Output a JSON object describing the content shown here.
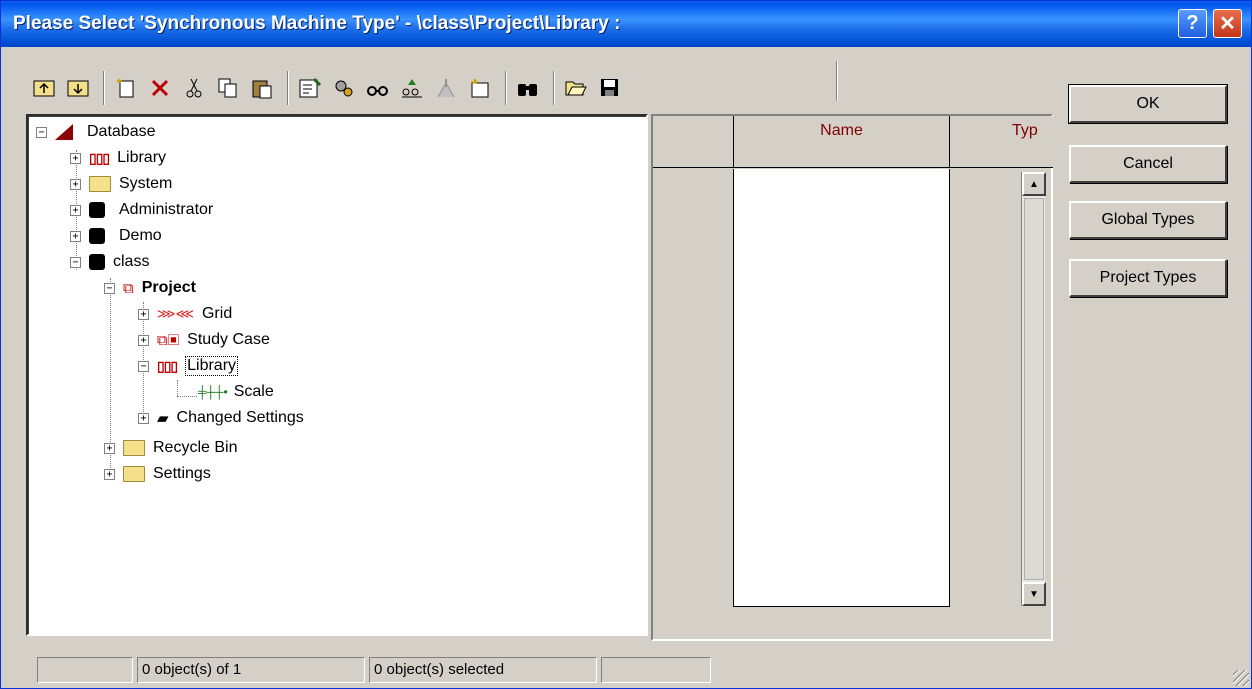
{
  "window": {
    "title": "Please Select 'Synchronous Machine Type' - \\class\\Project\\Library :",
    "help_label": "?",
    "close_label": "✕"
  },
  "toolbar": {
    "icons": [
      "folder-up-icon",
      "folder-down-icon",
      "new-object-icon",
      "delete-icon",
      "cut-icon",
      "copy-icon",
      "paste-icon",
      "edit-icon",
      "settings-icon",
      "view-icon",
      "filter-icon",
      "calculate-icon",
      "new-folder-icon",
      "find-icon",
      "open-icon",
      "save-icon"
    ]
  },
  "tree": {
    "items": [
      {
        "label": "Database",
        "expander": "−",
        "icon": "database-icon"
      },
      {
        "label": "Library",
        "expander": "+",
        "icon": "library-icon"
      },
      {
        "label": "System",
        "expander": "+",
        "icon": "folder-icon"
      },
      {
        "label": "Administrator",
        "expander": "+",
        "icon": "user-icon"
      },
      {
        "label": "Demo",
        "expander": "+",
        "icon": "user-icon"
      },
      {
        "label": "class",
        "expander": "−",
        "icon": "user-icon"
      },
      {
        "label": "Project",
        "expander": "−",
        "icon": "project-icon"
      },
      {
        "label": "Grid",
        "expander": "+",
        "icon": "grid-icon"
      },
      {
        "label": "Study Case",
        "expander": "+",
        "icon": "study-case-icon"
      },
      {
        "label": "Library",
        "expander": "−",
        "icon": "library-icon"
      },
      {
        "label": "Scale",
        "expander": "",
        "icon": "scale-icon"
      },
      {
        "label": "Changed Settings",
        "expander": "+",
        "icon": "changed-settings-icon"
      },
      {
        "label": "Recycle Bin",
        "expander": "+",
        "icon": "folder-icon"
      },
      {
        "label": "Settings",
        "expander": "+",
        "icon": "folder-icon"
      }
    ]
  },
  "list": {
    "columns": [
      "",
      "Name",
      "Typ"
    ]
  },
  "buttons": {
    "ok": "OK",
    "cancel": "Cancel",
    "global_types": "Global Types",
    "project_types": "Project Types"
  },
  "status": {
    "count": "0 object(s) of 1",
    "selected": "0 object(s) selected"
  }
}
